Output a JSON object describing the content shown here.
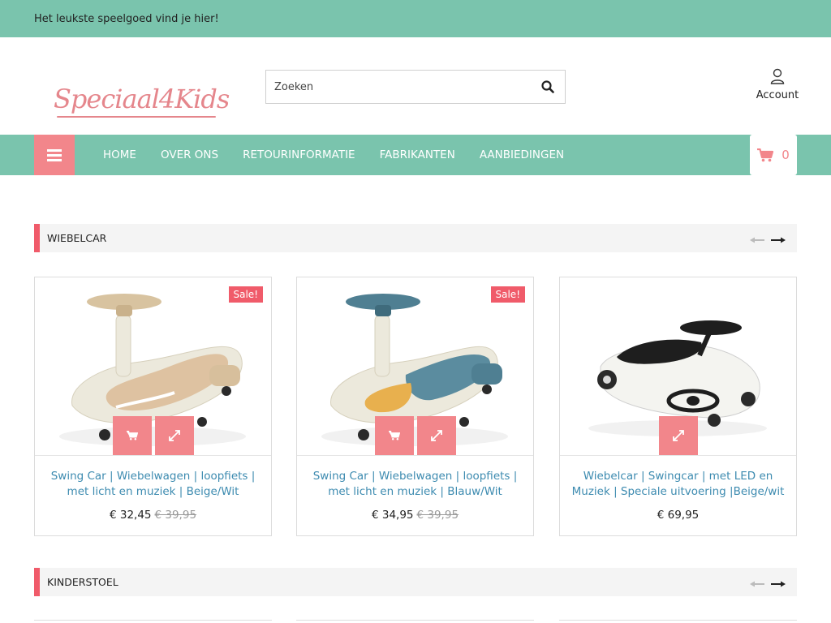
{
  "topbar": {
    "tagline": "Het leukste speelgoed vind je hier!"
  },
  "header": {
    "logo_text": "Speciaal4Kids",
    "search_placeholder": "Zoeken",
    "search_icon": "search-icon",
    "account_label": "Account",
    "account_icon": "user-icon"
  },
  "nav": {
    "menu_icon": "hamburger-icon",
    "links": [
      "HOME",
      "OVER ONS",
      "RETOURINFORMATIE",
      "FABRIKANTEN",
      "AANBIEDINGEN"
    ],
    "cart_icon": "cart-icon",
    "cart_count": "0"
  },
  "colors": {
    "accent_green": "#7ac4ad",
    "accent_pink": "#f2868b",
    "section_red": "#f05b6a",
    "link_blue": "#3d8bb0"
  },
  "sections": [
    {
      "title": "WIEBELCAR",
      "products": [
        {
          "name": "Swing Car | Wiebelwagen | loopfiets | met licht en muziek | Beige/Wit",
          "price": "€ 32,45",
          "old_price": "€ 39,95",
          "sale_label": "Sale!"
        },
        {
          "name": "Swing Car | Wiebelwagen | loopfiets | met licht en muziek | Blauw/Wit",
          "price": "€ 34,95",
          "old_price": "€ 39,95",
          "sale_label": "Sale!"
        },
        {
          "name": "Wiebelcar | Swingcar | met LED en Muziek | Speciale uitvoering |Beige/wit",
          "price": "€ 69,95"
        }
      ]
    },
    {
      "title": "KINDERSTOEL"
    }
  ]
}
